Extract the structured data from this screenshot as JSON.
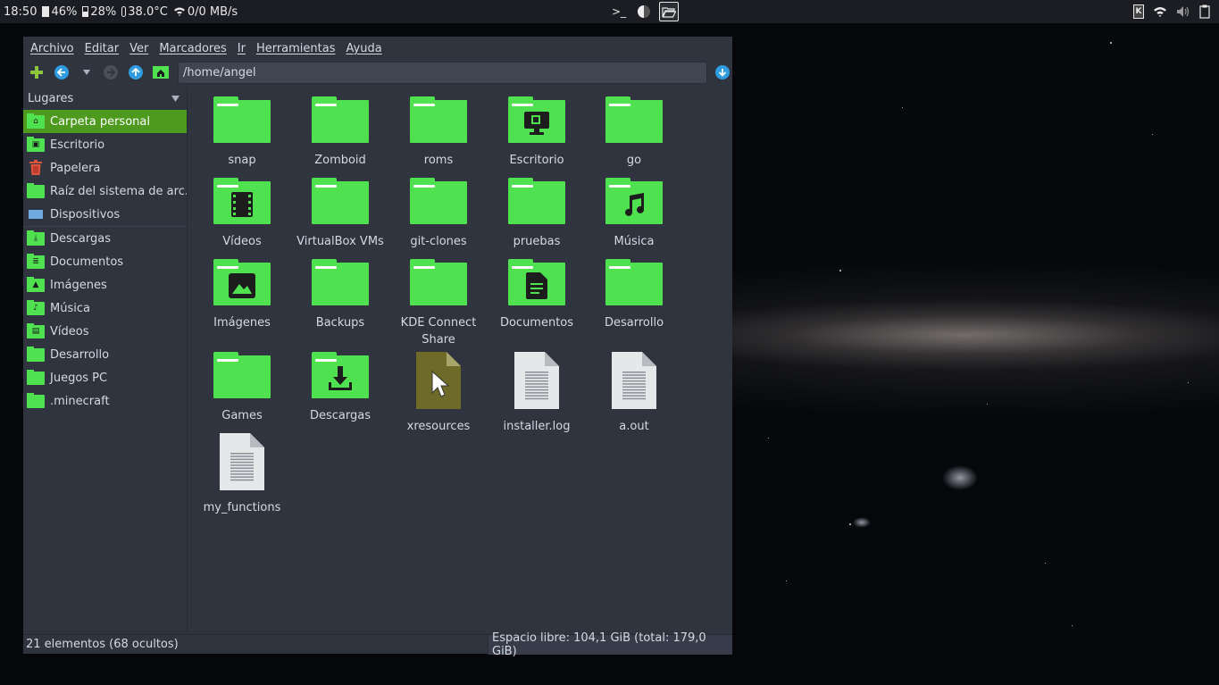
{
  "panel": {
    "time": "18:50",
    "cpu": "46%",
    "battery": "28%",
    "temperature": "38.0°C",
    "network": "0/0 MB/s",
    "terminal_glyph": ">_"
  },
  "window": {
    "menu": [
      "Archivo",
      "Editar",
      "Ver",
      "Marcadores",
      "Ir",
      "Herramientas",
      "Ayuda"
    ],
    "path": "/home/angel",
    "sidebar": {
      "header": "Lugares",
      "items": [
        {
          "label": "Carpeta personal",
          "icon": "home-folder-icon",
          "selected": true
        },
        {
          "label": "Escritorio",
          "icon": "desktop-folder-icon"
        },
        {
          "label": "Papelera",
          "icon": "trash-icon"
        },
        {
          "label": "Raíz del sistema de arc...",
          "icon": "folder-icon"
        },
        {
          "label": "Dispositivos",
          "icon": "drive-icon"
        },
        {
          "label": "Descargas",
          "icon": "downloads-folder-icon"
        },
        {
          "label": "Documentos",
          "icon": "documents-folder-icon"
        },
        {
          "label": "Imágenes",
          "icon": "pictures-folder-icon"
        },
        {
          "label": "Música",
          "icon": "music-folder-icon"
        },
        {
          "label": "Vídeos",
          "icon": "videos-folder-icon"
        },
        {
          "label": "Desarrollo",
          "icon": "folder-icon"
        },
        {
          "label": "Juegos PC",
          "icon": "folder-icon"
        },
        {
          "label": ".minecraft",
          "icon": "folder-icon"
        }
      ]
    },
    "files": [
      {
        "name": "snap",
        "kind": "folder"
      },
      {
        "name": "Zomboid",
        "kind": "folder"
      },
      {
        "name": "roms",
        "kind": "folder"
      },
      {
        "name": "Escritorio",
        "kind": "folder",
        "glyph": "desktop"
      },
      {
        "name": "go",
        "kind": "folder"
      },
      {
        "name": "Vídeos",
        "kind": "folder",
        "glyph": "video"
      },
      {
        "name": "VirtualBox VMs",
        "kind": "folder"
      },
      {
        "name": "git-clones",
        "kind": "folder"
      },
      {
        "name": "pruebas",
        "kind": "folder"
      },
      {
        "name": "Música",
        "kind": "folder",
        "glyph": "music"
      },
      {
        "name": "Imágenes",
        "kind": "folder",
        "glyph": "image"
      },
      {
        "name": "Backups",
        "kind": "folder"
      },
      {
        "name": "KDE Connect Share",
        "kind": "folder"
      },
      {
        "name": "Documentos",
        "kind": "folder",
        "glyph": "document"
      },
      {
        "name": "Desarrollo",
        "kind": "folder"
      },
      {
        "name": "Games",
        "kind": "folder"
      },
      {
        "name": "Descargas",
        "kind": "folder",
        "glyph": "download"
      },
      {
        "name": "xresources",
        "kind": "cursor-file"
      },
      {
        "name": "installer.log",
        "kind": "text-file"
      },
      {
        "name": "a.out",
        "kind": "text-file"
      },
      {
        "name": "my_functions",
        "kind": "text-file"
      }
    ],
    "status_left": "21 elementos (68 ocultos)",
    "status_right": "Espacio libre: 104,1 GiB (total: 179,0 GiB)"
  },
  "colors": {
    "folder": "#4fe14f",
    "selection": "#4e9a1f",
    "window_bg": "#2f343f",
    "accent_blue": "#2f9ce0"
  }
}
